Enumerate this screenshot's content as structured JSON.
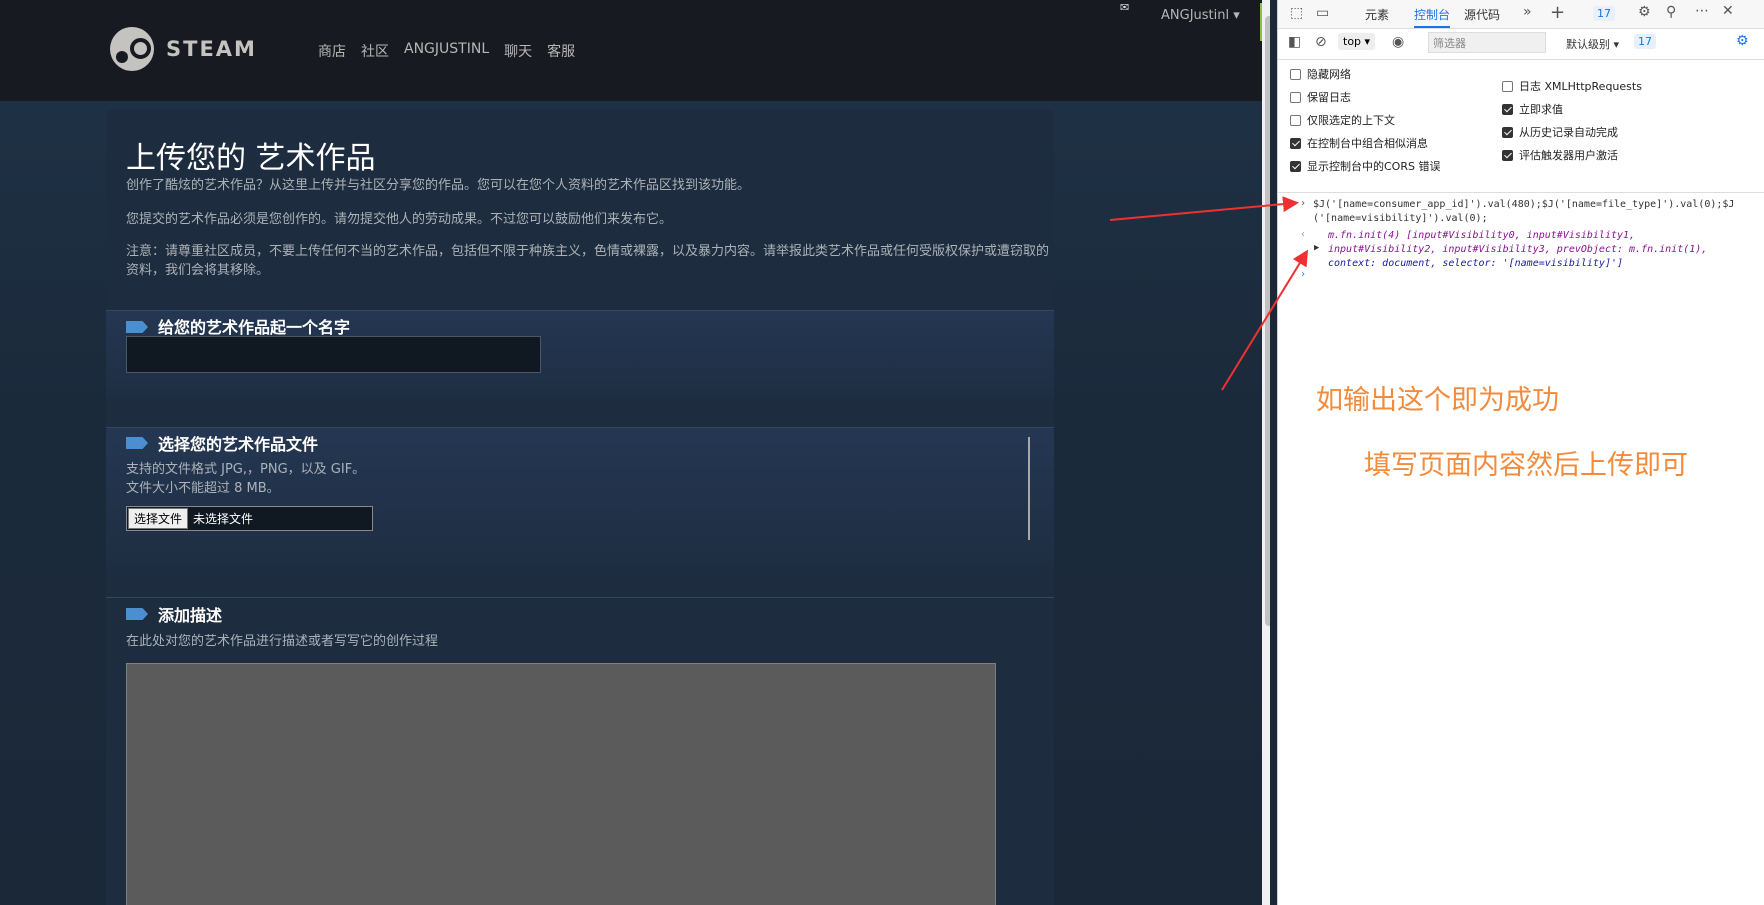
{
  "header": {
    "logo_text": "STEAM",
    "nav": [
      "商店",
      "社区",
      "ANGJUSTINL",
      "聊天",
      "客服"
    ],
    "account_name": "ANGJustinl",
    "mail_icon": "✉"
  },
  "page": {
    "title": "上传您的 艺术作品",
    "intro": "创作了酷炫的艺术作品？从这里上传并与社区分享您的作品。您可以在您个人资料的艺术作品区找到该功能。",
    "notice1": "您提交的艺术作品必须是您创作的。请勿提交他人的劳动成果。不过您可以鼓励他们来发布它。",
    "notice2": "注意：请尊重社区成员，不要上传任何不当的艺术作品，包括但不限于种族主义，色情或裸露，以及暴力内容。请举报此类艺术作品或任何受版权保护或遭窃取的资料，我们会将其移除。",
    "section_name_title": "给您的艺术作品起一个名字",
    "section_file_title": "选择您的艺术作品文件",
    "file_formats": "支持的文件格式 JPG,，PNG，以及 GIF。",
    "file_size": "文件大小不能超过 8 MB。",
    "file_button": "选择文件",
    "file_none": "未选择文件",
    "section_desc_title": "添加描述",
    "desc_hint": "在此处对您的艺术作品进行描述或者写写它的创作过程"
  },
  "devtools": {
    "tabs": [
      "元素",
      "控制台",
      "源代码"
    ],
    "badge_count": "17",
    "context": "top",
    "filter_placeholder": "筛选器",
    "level": "默认级别",
    "options_left": [
      {
        "label": "隐藏网络",
        "checked": false
      },
      {
        "label": "保留日志",
        "checked": false
      },
      {
        "label": "仅限选定的上下文",
        "checked": false
      },
      {
        "label": "在控制台中组合相似消息",
        "checked": true
      },
      {
        "label": "显示控制台中的CORS 错误",
        "checked": true
      }
    ],
    "options_right": [
      {
        "label": "日志 XMLHttpRequests",
        "checked": false
      },
      {
        "label": "立即求值",
        "checked": true
      },
      {
        "label": "从历史记录自动完成",
        "checked": true
      },
      {
        "label": "评估触发器用户激活",
        "checked": true
      }
    ],
    "command": "$J('[name=consumer_app_id]').val(480);$J('[name=file_type]').val(0);$J('[name=visibility]').val(0);",
    "output_line1": "m.fn.init(4) [input#Visibility0, input#Visibility1,",
    "output_line2": "input#Visibility2, input#Visibility3, prevObject: m.fn.init(1),",
    "output_line3": "context: document, selector: '[name=visibility]']"
  },
  "annotations": {
    "success": "如输出这个即为成功",
    "next": "填写页面内容然后上传即可",
    "color": "#f28b3c",
    "arrow_color": "#f03030"
  }
}
